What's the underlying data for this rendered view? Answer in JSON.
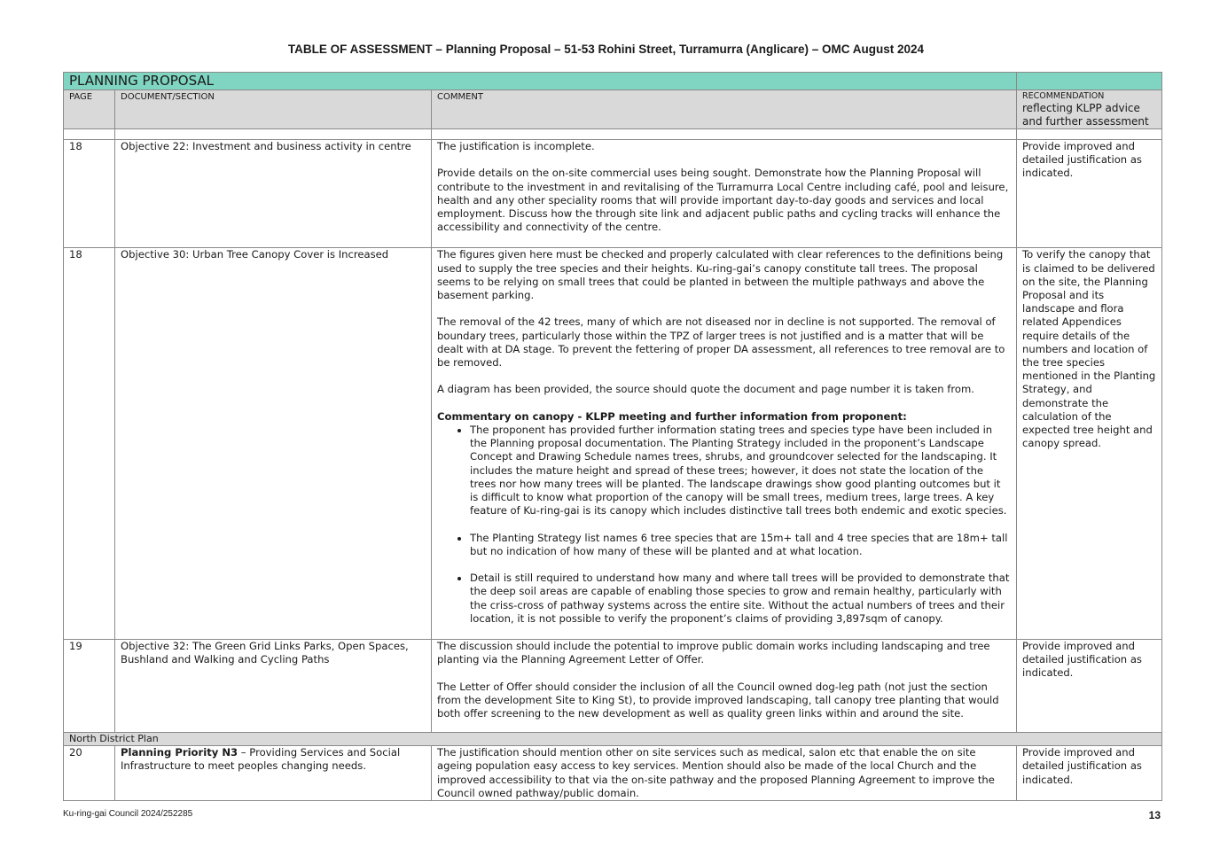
{
  "title": "TABLE OF ASSESSMENT – Planning Proposal – 51-53 Rohini Street, Turramurra (Anglicare) – OMC August 2024",
  "band_label": "PLANNING PROPOSAL",
  "headers": {
    "page": "PAGE",
    "section": "DOCUMENT/SECTION",
    "comment": "COMMENT",
    "rec_small": "RECOMMENDATION",
    "rec_big": "reflecting KLPP advice and further assessment"
  },
  "rows": [
    {
      "page": "18",
      "section": "Objective 22:  Investment and business activity in centre",
      "comment": [
        "The justification is incomplete.",
        "Provide details on the on-site commercial uses being sought. Demonstrate how the Planning Proposal will contribute to the investment in and revitalising of the Turramurra Local Centre including café, pool and leisure, health and any other speciality rooms that will provide important day-to-day goods and services and local employment. Discuss how the through site link and adjacent public paths and cycling tracks will enhance the accessibility and connectivity of the centre."
      ],
      "recommendation": "Provide improved and detailed justification as indicated."
    },
    {
      "page": "18",
      "section": "Objective 30: Urban Tree Canopy Cover is Increased",
      "comment": [
        "The figures given here must be checked and properly calculated with clear references to the definitions being used to supply the tree species and their heights. Ku-ring-gai’s canopy constitute tall trees. The proposal seems to be relying on small trees that could be planted in between the multiple pathways and above the basement parking.",
        "The removal of the 42 trees, many of which are not diseased nor in decline is not supported. The removal of boundary trees, particularly those within the TPZ of larger trees is not justified and is a matter that will be dealt with at DA stage. To prevent the fettering of proper DA assessment, all references to tree removal are to be removed.",
        "A diagram has been provided, the source should quote the document and page number it is taken from."
      ],
      "comment_heading": "Commentary on canopy - KLPP meeting and further information from proponent:",
      "bullets": [
        "The proponent has provided further information stating trees and species type have been included in the Planning proposal documentation. The Planting Strategy included in the proponent’s Landscape Concept and Drawing Schedule names trees, shrubs, and groundcover selected for the landscaping. It includes the mature height and spread of these trees; however, it does not state the location of the trees nor how many trees will be planted. The landscape drawings show good planting outcomes but it is difficult to know what proportion of the canopy will be small trees, medium trees, large trees. A key feature of Ku-ring-gai is its canopy which includes distinctive tall trees both endemic and exotic species.",
        "The Planting Strategy list names 6 tree species that are 15m+ tall and 4 tree species that are 18m+ tall but no indication of how many of these will be planted and at what location.",
        "Detail is still required to understand how many and where tall trees will be provided to demonstrate that the deep soil areas are capable of enabling those species to grow and remain healthy, particularly with the criss-cross of pathway systems across the entire site. Without the actual numbers of trees and their location, it is not possible to verify the proponent’s claims of providing 3,897sqm of canopy."
      ],
      "recommendation": "To verify the canopy that is claimed to be delivered on the site, the Planning Proposal and its landscape and flora related Appendices require details of the numbers and location of the tree species mentioned in the Planting Strategy, and demonstrate the calculation of the expected tree height and canopy spread."
    },
    {
      "page": "19",
      "section": "Objective 32: The Green Grid Links Parks, Open Spaces, Bushland and Walking and Cycling Paths",
      "comment": [
        "The discussion should include the potential to improve public domain works including landscaping and tree planting via the Planning Agreement Letter of Offer.",
        "The Letter of Offer should consider the inclusion of all the Council owned dog-leg path (not just the section from the development Site to King St), to provide improved landscaping, tall canopy tree planting that would both offer screening to the new development as well as quality green links within and around the site."
      ],
      "recommendation": "Provide improved and detailed justification as indicated."
    }
  ],
  "section_label": "North District Plan",
  "last_row": {
    "page": "20",
    "section_bold": "Planning Priority N3",
    "section_rest": " – Providing Services and Social Infrastructure to meet peoples changing needs.",
    "comment": "The justification should mention other on site services such as medical, salon etc that enable the on site ageing population easy access to key services. Mention should also be made of the local Church  and the improved accessibility to that via the on-site pathway and the proposed Planning Agreement to improve the Council owned pathway/public domain.",
    "recommendation": "Provide improved and detailed justification as indicated."
  },
  "footer": {
    "reference": "Ku-ring-gai Council 2024/252285",
    "page_number": "13"
  }
}
